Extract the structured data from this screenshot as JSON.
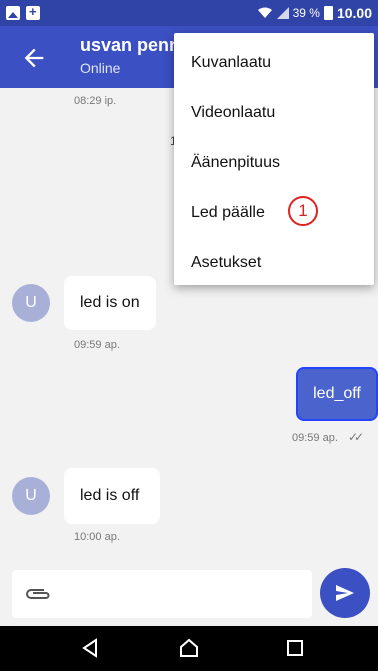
{
  "status_bar": {
    "battery": "39 %",
    "time": "10.00"
  },
  "header": {
    "contact_name": "usvan penn",
    "status": "Online"
  },
  "messages": [
    {
      "direction": "in",
      "timestamp": "08:29 ip."
    },
    {
      "direction": "in",
      "avatar_letter": "U",
      "text": "led is on",
      "timestamp": "09:59 ap."
    },
    {
      "direction": "out",
      "text": "led_off",
      "timestamp": "09:59 ap.",
      "ticks": "✓✓"
    },
    {
      "direction": "in",
      "avatar_letter": "U",
      "text": "led is off",
      "timestamp": "10:00 ap."
    }
  ],
  "hidden_fragment": "1",
  "composer": {
    "placeholder": ""
  },
  "menu": {
    "items": [
      "Kuvanlaatu",
      "Videonlaatu",
      "Äänenpituus",
      "Led päälle",
      "Asetukset"
    ],
    "annotation": "1"
  },
  "colors": {
    "primary": "#3b50c2",
    "status_bar": "#3044a8",
    "outgoing_bubble": "#4b64cd",
    "annotation": "#dd2222"
  },
  "icons": [
    "image-icon",
    "sim-icon",
    "wifi-icon",
    "signal-icon",
    "battery-icon",
    "back-arrow-icon",
    "attach-icon",
    "send-icon",
    "nav-back-icon",
    "nav-home-icon",
    "nav-recents-icon"
  ]
}
